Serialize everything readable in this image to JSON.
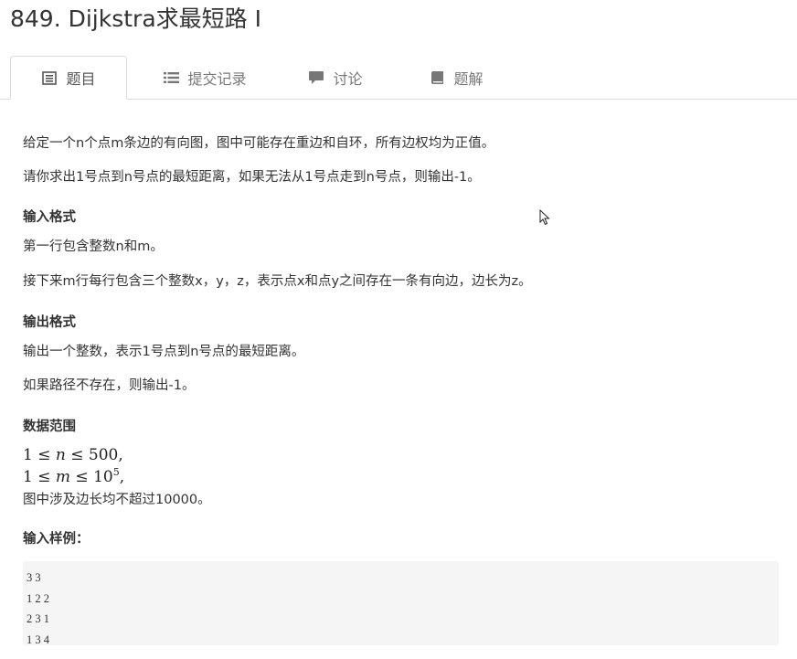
{
  "title": "849. Dijkstra求最短路 I",
  "tabs": [
    {
      "label": "题目",
      "icon": "list-icon",
      "active": true
    },
    {
      "label": "提交记录",
      "icon": "records-icon",
      "active": false
    },
    {
      "label": "讨论",
      "icon": "comment-icon",
      "active": false
    },
    {
      "label": "题解",
      "icon": "book-icon",
      "active": false
    }
  ],
  "problem": {
    "desc1": "给定一个n个点m条边的有向图，图中可能存在重边和自环，所有边权均为正值。",
    "desc2": "请你求出1号点到n号点的最短距离，如果无法从1号点走到n号点，则输出-1。",
    "input_heading": "输入格式",
    "input1": "第一行包含整数n和m。",
    "input2": "接下来m行每行包含三个整数x，y，z，表示点x和点y之间存在一条有向边，边长为z。",
    "output_heading": "输出格式",
    "output1": "输出一个整数，表示1号点到n号点的最短距离。",
    "output2": "如果路径不存在，则输出-1。",
    "range_heading": "数据范围",
    "range_n": {
      "lhs": "1",
      "var": "n",
      "rhs": "500"
    },
    "range_m": {
      "lhs": "1",
      "var": "m",
      "base": "10",
      "exp": "5"
    },
    "range_note": "图中涉及边长均不超过10000。",
    "sample_heading": "输入样例：",
    "sample_lines": [
      "3 3",
      "1 2 2",
      "2 3 1",
      "1 3 4"
    ]
  },
  "colors": {
    "text": "#333333",
    "tab_text": "#777777",
    "border": "#dddddd",
    "code_bg": "#f5f5f5"
  }
}
